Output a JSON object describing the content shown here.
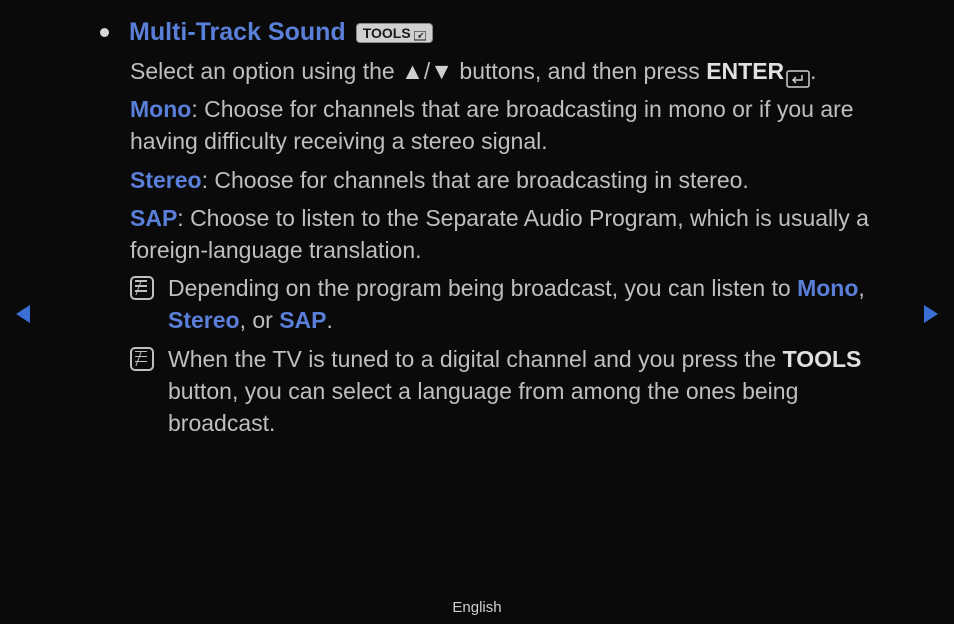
{
  "title": "Multi-Track Sound",
  "tools_badge": "TOOLS",
  "intro_part1": "Select an option using the ",
  "intro_up": "▲",
  "intro_slash": "/",
  "intro_down": "▼",
  "intro_part2": " buttons, and then press ",
  "intro_enter": "ENTER",
  "intro_period": ".",
  "mono_label": "Mono",
  "mono_desc": ": Choose for channels that are broadcasting in mono or if you are having difficulty receiving a stereo signal.",
  "stereo_label": "Stereo",
  "stereo_desc": ": Choose for channels that are broadcasting in stereo.",
  "sap_label": "SAP",
  "sap_desc": ": Choose to listen to the Separate Audio Program, which is usually a foreign-language translation.",
  "note1_part1": "Depending on the program being broadcast, you can listen to ",
  "note1_mono": "Mono",
  "note1_comma1": ", ",
  "note1_stereo": "Stereo",
  "note1_comma2": ", or ",
  "note1_sap": "SAP",
  "note1_period": ".",
  "note2_part1": "When the TV is tuned to a digital channel and you press the ",
  "note2_tools": "TOOLS",
  "note2_part2": " button, you can select a language from among the ones being broadcast.",
  "footer_language": "English"
}
